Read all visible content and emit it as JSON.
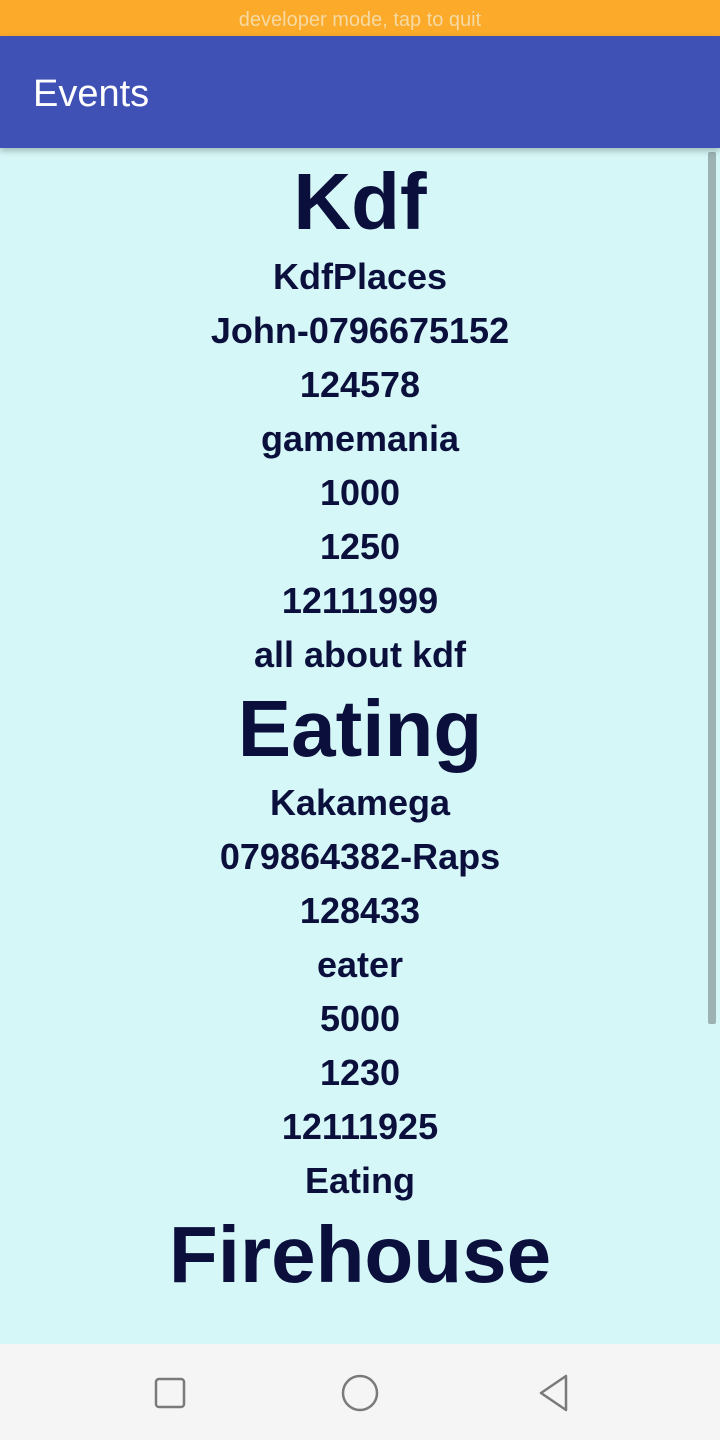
{
  "status_banner": "developer mode, tap to quit",
  "app_bar": {
    "title": "Events"
  },
  "events": [
    {
      "name": "Kdf",
      "location": "KdfPlaces",
      "contact": "John-0796675152",
      "code": "124578",
      "organizer": "gamemania",
      "value1": "1000",
      "value2": "1250",
      "date": "12111999",
      "description": "all about kdf"
    },
    {
      "name": "Eating",
      "location": "Kakamega",
      "contact": "079864382-Raps",
      "code": "128433",
      "organizer": "eater",
      "value1": "5000",
      "value2": "1230",
      "date": "12111925",
      "description": "Eating"
    },
    {
      "name": "Firehouse"
    }
  ],
  "nav": {
    "recents_icon": "square-icon",
    "home_icon": "circle-icon",
    "back_icon": "triangle-back-icon"
  },
  "colors": {
    "banner": "#fbab29",
    "app_bar": "#3f51b5",
    "background": "#d6f7f7",
    "text": "#0a0f3c"
  }
}
